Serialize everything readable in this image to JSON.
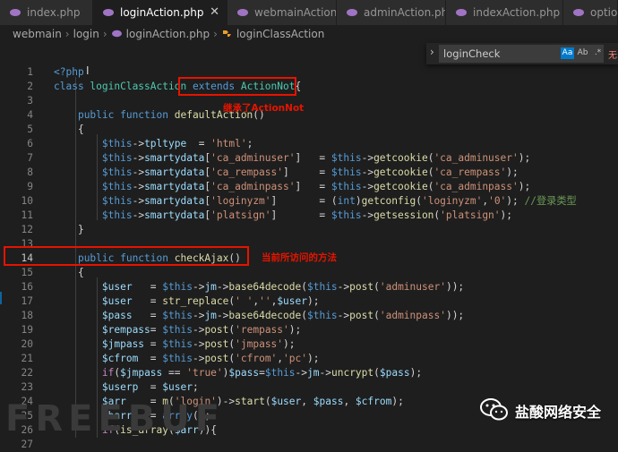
{
  "tabs": [
    {
      "label": "index.php",
      "active": false
    },
    {
      "label": "loginAction.php",
      "active": true
    },
    {
      "label": "webmainAction.php",
      "active": false
    },
    {
      "label": "adminAction.php",
      "active": false
    },
    {
      "label": "indexAction.php",
      "active": false
    },
    {
      "label": "optio",
      "active": false
    }
  ],
  "breadcrumb": {
    "parts": [
      "webmain",
      "login",
      "loginAction.php",
      "loginClassAction"
    ],
    "class_icon": "class-icon",
    "file_icon": "php-elephant-icon"
  },
  "find_widget": {
    "query": "loginCheck",
    "match_case": "Aa",
    "whole_word": "Ab",
    "regex": ".*",
    "result": "无"
  },
  "annotations": {
    "extends_note": "继承了ActionNot",
    "method_note": "当前所访问的方法"
  },
  "watermark": {
    "text": "盐酸网络安全"
  },
  "ghost_text": "FREEBUF",
  "colors": {
    "accent": "#007acc",
    "annotation": "#e51400"
  },
  "code_lines": [
    {
      "n": "1",
      "tokens": [
        [
          "k",
          "<?php"
        ]
      ]
    },
    {
      "n": "2",
      "tokens": [
        [
          "k",
          "class "
        ],
        [
          "ty",
          "loginClassAction"
        ],
        [
          "p",
          " "
        ],
        [
          "k",
          "extends"
        ],
        [
          "p",
          " "
        ],
        [
          "ty",
          "ActionNot"
        ],
        [
          "p",
          "{"
        ]
      ]
    },
    {
      "n": "3",
      "tokens": []
    },
    {
      "n": "4",
      "tokens": [
        [
          "p",
          "    "
        ],
        [
          "k",
          "public function "
        ],
        [
          "f",
          "defaultAction"
        ],
        [
          "p",
          "()"
        ]
      ]
    },
    {
      "n": "5",
      "tokens": [
        [
          "p",
          "    {"
        ]
      ]
    },
    {
      "n": "6",
      "tokens": [
        [
          "p",
          "        "
        ],
        [
          "k",
          "$this"
        ],
        [
          "p",
          "->"
        ],
        [
          "v",
          "tpltype"
        ],
        [
          "p",
          "  = "
        ],
        [
          "s",
          "'html'"
        ],
        [
          "p",
          ";"
        ]
      ]
    },
    {
      "n": "7",
      "tokens": [
        [
          "p",
          "        "
        ],
        [
          "k",
          "$this"
        ],
        [
          "p",
          "->"
        ],
        [
          "v",
          "smartydata"
        ],
        [
          "p",
          "["
        ],
        [
          "s",
          "'ca_adminuser'"
        ],
        [
          "p",
          "]   = "
        ],
        [
          "k",
          "$this"
        ],
        [
          "p",
          "->"
        ],
        [
          "f",
          "getcookie"
        ],
        [
          "p",
          "("
        ],
        [
          "s",
          "'ca_adminuser'"
        ],
        [
          "p",
          ");"
        ]
      ]
    },
    {
      "n": "8",
      "tokens": [
        [
          "p",
          "        "
        ],
        [
          "k",
          "$this"
        ],
        [
          "p",
          "->"
        ],
        [
          "v",
          "smartydata"
        ],
        [
          "p",
          "["
        ],
        [
          "s",
          "'ca_rempass'"
        ],
        [
          "p",
          "]     = "
        ],
        [
          "k",
          "$this"
        ],
        [
          "p",
          "->"
        ],
        [
          "f",
          "getcookie"
        ],
        [
          "p",
          "("
        ],
        [
          "s",
          "'ca_rempass'"
        ],
        [
          "p",
          ");"
        ]
      ]
    },
    {
      "n": "9",
      "tokens": [
        [
          "p",
          "        "
        ],
        [
          "k",
          "$this"
        ],
        [
          "p",
          "->"
        ],
        [
          "v",
          "smartydata"
        ],
        [
          "p",
          "["
        ],
        [
          "s",
          "'ca_adminpass'"
        ],
        [
          "p",
          "]   = "
        ],
        [
          "k",
          "$this"
        ],
        [
          "p",
          "->"
        ],
        [
          "f",
          "getcookie"
        ],
        [
          "p",
          "("
        ],
        [
          "s",
          "'ca_adminpass'"
        ],
        [
          "p",
          ");"
        ]
      ]
    },
    {
      "n": "10",
      "tokens": [
        [
          "p",
          "        "
        ],
        [
          "k",
          "$this"
        ],
        [
          "p",
          "->"
        ],
        [
          "v",
          "smartydata"
        ],
        [
          "p",
          "["
        ],
        [
          "s",
          "'loginyzm'"
        ],
        [
          "p",
          "]       = ("
        ],
        [
          "k",
          "int"
        ],
        [
          "p",
          ")"
        ],
        [
          "f",
          "getconfig"
        ],
        [
          "p",
          "("
        ],
        [
          "s",
          "'loginyzm'"
        ],
        [
          "p",
          ","
        ],
        [
          "s",
          "'0'"
        ],
        [
          "p",
          "); "
        ],
        [
          "c",
          "//登录类型"
        ]
      ]
    },
    {
      "n": "11",
      "tokens": [
        [
          "p",
          "        "
        ],
        [
          "k",
          "$this"
        ],
        [
          "p",
          "->"
        ],
        [
          "v",
          "smartydata"
        ],
        [
          "p",
          "["
        ],
        [
          "s",
          "'platsign'"
        ],
        [
          "p",
          "]       = "
        ],
        [
          "k",
          "$this"
        ],
        [
          "p",
          "->"
        ],
        [
          "f",
          "getsession"
        ],
        [
          "p",
          "("
        ],
        [
          "s",
          "'platsign'"
        ],
        [
          "p",
          ");"
        ]
      ]
    },
    {
      "n": "12",
      "tokens": [
        [
          "p",
          "    }"
        ]
      ]
    },
    {
      "n": "13",
      "tokens": []
    },
    {
      "n": "14",
      "tokens": [
        [
          "p",
          "    "
        ],
        [
          "k",
          "public function "
        ],
        [
          "f",
          "checkAjax"
        ],
        [
          "p",
          "()"
        ]
      ]
    },
    {
      "n": "15",
      "tokens": [
        [
          "p",
          "    {"
        ]
      ]
    },
    {
      "n": "16",
      "tokens": [
        [
          "p",
          "        "
        ],
        [
          "v",
          "$user"
        ],
        [
          "p",
          "   = "
        ],
        [
          "k",
          "$this"
        ],
        [
          "p",
          "->"
        ],
        [
          "v",
          "jm"
        ],
        [
          "p",
          "->"
        ],
        [
          "f",
          "base64decode"
        ],
        [
          "p",
          "("
        ],
        [
          "k",
          "$this"
        ],
        [
          "p",
          "->"
        ],
        [
          "f",
          "post"
        ],
        [
          "p",
          "("
        ],
        [
          "s",
          "'adminuser'"
        ],
        [
          "p",
          "));"
        ]
      ]
    },
    {
      "n": "17",
      "tokens": [
        [
          "p",
          "        "
        ],
        [
          "v",
          "$user"
        ],
        [
          "p",
          "   = "
        ],
        [
          "f",
          "str_replace"
        ],
        [
          "p",
          "("
        ],
        [
          "s",
          "' '"
        ],
        [
          "p",
          ","
        ],
        [
          "s",
          "''"
        ],
        [
          "p",
          ","
        ],
        [
          "v",
          "$user"
        ],
        [
          "p",
          ");"
        ]
      ]
    },
    {
      "n": "18",
      "tokens": [
        [
          "p",
          "        "
        ],
        [
          "v",
          "$pass"
        ],
        [
          "p",
          "   = "
        ],
        [
          "k",
          "$this"
        ],
        [
          "p",
          "->"
        ],
        [
          "v",
          "jm"
        ],
        [
          "p",
          "->"
        ],
        [
          "f",
          "base64decode"
        ],
        [
          "p",
          "("
        ],
        [
          "k",
          "$this"
        ],
        [
          "p",
          "->"
        ],
        [
          "f",
          "post"
        ],
        [
          "p",
          "("
        ],
        [
          "s",
          "'adminpass'"
        ],
        [
          "p",
          "));"
        ]
      ]
    },
    {
      "n": "19",
      "tokens": [
        [
          "p",
          "        "
        ],
        [
          "v",
          "$rempass"
        ],
        [
          "p",
          "= "
        ],
        [
          "k",
          "$this"
        ],
        [
          "p",
          "->"
        ],
        [
          "f",
          "post"
        ],
        [
          "p",
          "("
        ],
        [
          "s",
          "'rempass'"
        ],
        [
          "p",
          ");"
        ]
      ]
    },
    {
      "n": "20",
      "tokens": [
        [
          "p",
          "        "
        ],
        [
          "v",
          "$jmpass"
        ],
        [
          "p",
          " = "
        ],
        [
          "k",
          "$this"
        ],
        [
          "p",
          "->"
        ],
        [
          "f",
          "post"
        ],
        [
          "p",
          "("
        ],
        [
          "s",
          "'jmpass'"
        ],
        [
          "p",
          ");"
        ]
      ]
    },
    {
      "n": "21",
      "tokens": [
        [
          "p",
          "        "
        ],
        [
          "v",
          "$cfrom"
        ],
        [
          "p",
          "  = "
        ],
        [
          "k",
          "$this"
        ],
        [
          "p",
          "->"
        ],
        [
          "f",
          "post"
        ],
        [
          "p",
          "("
        ],
        [
          "s",
          "'cfrom'"
        ],
        [
          "p",
          ","
        ],
        [
          "s",
          "'pc'"
        ],
        [
          "p",
          ");"
        ]
      ]
    },
    {
      "n": "22",
      "tokens": [
        [
          "p",
          "        "
        ],
        [
          "ctl",
          "if"
        ],
        [
          "p",
          "("
        ],
        [
          "v",
          "$jmpass"
        ],
        [
          "p",
          " == "
        ],
        [
          "s",
          "'true'"
        ],
        [
          "p",
          ")"
        ],
        [
          "v",
          "$pass"
        ],
        [
          "p",
          "="
        ],
        [
          "k",
          "$this"
        ],
        [
          "p",
          "->"
        ],
        [
          "v",
          "jm"
        ],
        [
          "p",
          "->"
        ],
        [
          "f",
          "uncrypt"
        ],
        [
          "p",
          "("
        ],
        [
          "v",
          "$pass"
        ],
        [
          "p",
          ");"
        ]
      ]
    },
    {
      "n": "23",
      "tokens": [
        [
          "p",
          "        "
        ],
        [
          "v",
          "$userp"
        ],
        [
          "p",
          "  = "
        ],
        [
          "v",
          "$user"
        ],
        [
          "p",
          ";"
        ]
      ]
    },
    {
      "n": "24",
      "tokens": [
        [
          "p",
          "        "
        ],
        [
          "v",
          "$arr"
        ],
        [
          "p",
          "    = "
        ],
        [
          "f",
          "m"
        ],
        [
          "p",
          "("
        ],
        [
          "s",
          "'login'"
        ],
        [
          "p",
          ")->"
        ],
        [
          "f",
          "start"
        ],
        [
          "p",
          "("
        ],
        [
          "v",
          "$user"
        ],
        [
          "p",
          ", "
        ],
        [
          "v",
          "$pass"
        ],
        [
          "p",
          ", "
        ],
        [
          "v",
          "$cfrom"
        ],
        [
          "p",
          ");"
        ]
      ]
    },
    {
      "n": "25",
      "tokens": [
        [
          "p",
          "        "
        ],
        [
          "v",
          "$barr"
        ],
        [
          "p",
          "   = "
        ],
        [
          "k",
          "array"
        ],
        [
          "p",
          "();"
        ]
      ]
    },
    {
      "n": "26",
      "tokens": [
        [
          "p",
          "        "
        ],
        [
          "ctl",
          "if"
        ],
        [
          "p",
          "("
        ],
        [
          "f",
          "is_array"
        ],
        [
          "p",
          "("
        ],
        [
          "v",
          "$arr"
        ],
        [
          "p",
          ")){"
        ]
      ]
    },
    {
      "n": "27",
      "tokens": []
    }
  ]
}
